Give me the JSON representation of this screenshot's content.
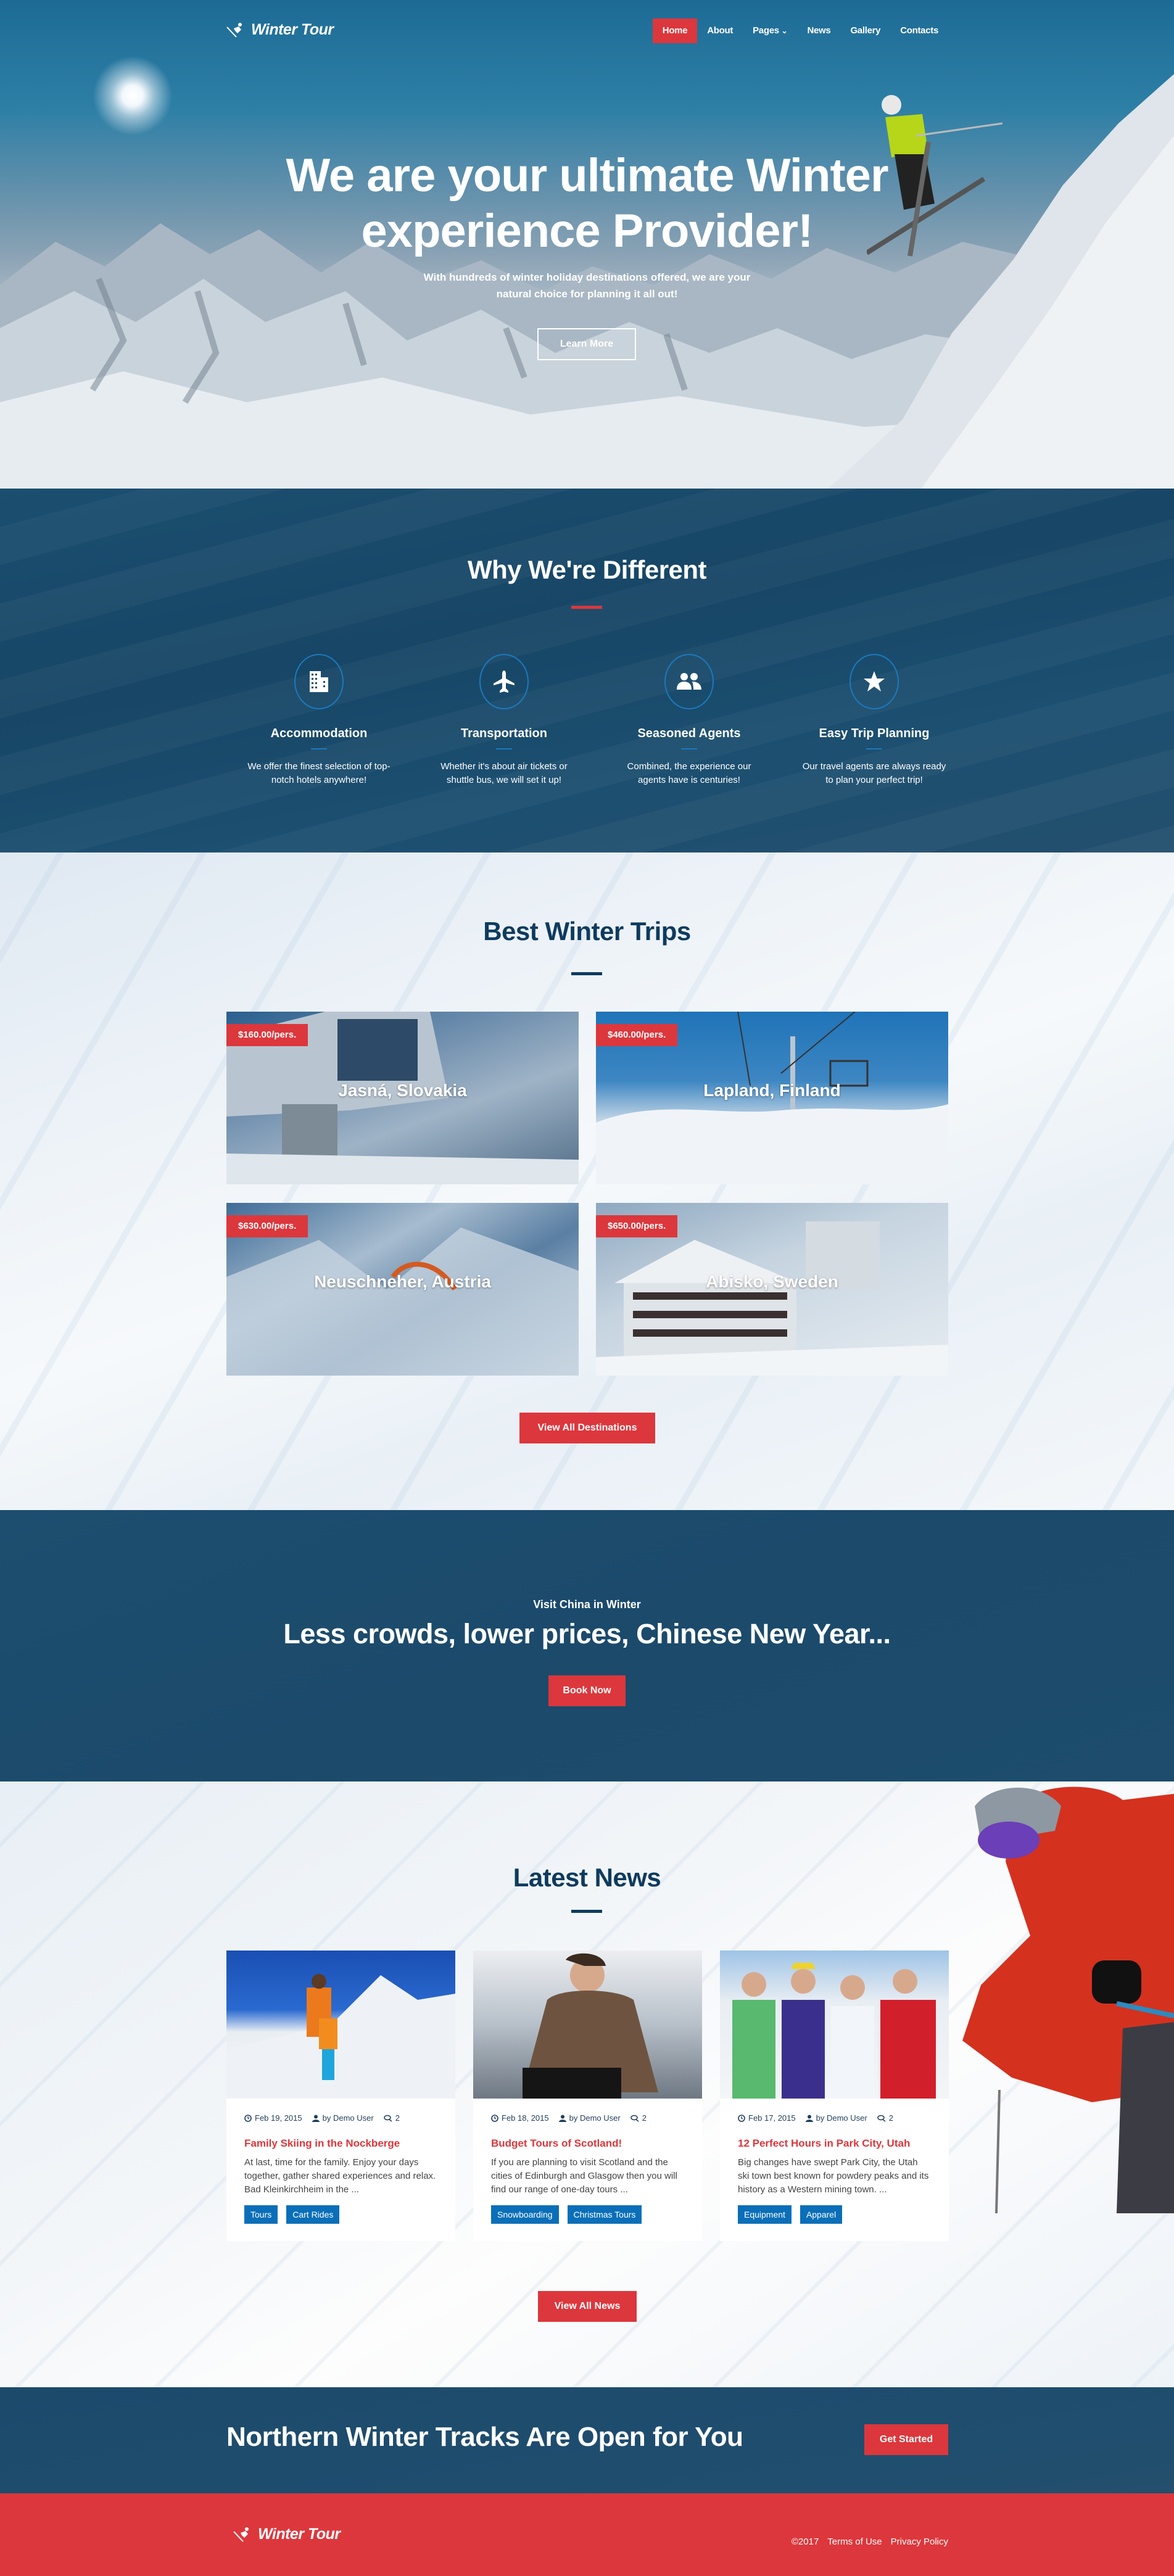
{
  "brand": {
    "name": "Winter Tour",
    "icon": "skier-logo-icon"
  },
  "nav": {
    "items": [
      {
        "label": "Home",
        "active": true
      },
      {
        "label": "About",
        "active": false
      },
      {
        "label": "Pages",
        "active": false,
        "has_dropdown": true
      },
      {
        "label": "News",
        "active": false
      },
      {
        "label": "Gallery",
        "active": false
      },
      {
        "label": "Contacts",
        "active": false
      }
    ],
    "dropdown_glyph": "⌄"
  },
  "hero": {
    "title_line1": "We are your ultimate Winter",
    "title_line2": "experience Provider!",
    "subtitle_line1": "With hundreds of winter holiday destinations offered, we are your",
    "subtitle_line2": "natural choice for planning it all out!",
    "button": "Learn More"
  },
  "why": {
    "title": "Why We're Different",
    "features": [
      {
        "icon": "building-icon",
        "title": "Accommodation",
        "text": "We offer the finest selection of top-notch hotels anywhere!"
      },
      {
        "icon": "airplane-icon",
        "title": "Transportation",
        "text": "Whether it's about air tickets or shuttle bus, we will set it up!"
      },
      {
        "icon": "people-icon",
        "title": "Seasoned Agents",
        "text": "Combined, the experience our agents have is centuries!"
      },
      {
        "icon": "star-icon",
        "title": "Easy Trip Planning",
        "text": "Our travel agents are always ready to plan your perfect trip!"
      }
    ]
  },
  "trips": {
    "title": "Best Winter Trips",
    "items": [
      {
        "price": "$160.00/pers.",
        "name": "Jasná, Slovakia"
      },
      {
        "price": "$460.00/pers.",
        "name": "Lapland, Finland"
      },
      {
        "price": "$630.00/pers.",
        "name": "Neuschneher, Austria"
      },
      {
        "price": "$650.00/pers.",
        "name": "Abisko, Sweden"
      }
    ],
    "button": "View All Destinations"
  },
  "cta": {
    "subtitle": "Visit China in Winter",
    "title": "Less crowds, lower prices, Chinese New Year...",
    "button": "Book Now"
  },
  "news": {
    "title": "Latest News",
    "posts": [
      {
        "date": "Feb 19, 2015",
        "author": "by Demo User",
        "comments": "2",
        "title": "Family Skiing in the Nockberge",
        "excerpt": "At last, time for the family. Enjoy your days together, gather shared experiences and relax. Bad Kleinkirchheim in the ...",
        "tags": [
          "Tours",
          "Cart Rides"
        ]
      },
      {
        "date": "Feb 18, 2015",
        "author": "by Demo User",
        "comments": "2",
        "title": "Budget Tours of Scotland!",
        "excerpt": "If you are planning to visit Scotland and the cities of Edinburgh and Glasgow then you will find our range of one-day tours ...",
        "tags": [
          "Snowboarding",
          "Christmas Tours"
        ]
      },
      {
        "date": "Feb 17, 2015",
        "author": "by Demo User",
        "comments": "2",
        "title": "12 Perfect Hours in Park City, Utah",
        "excerpt": "Big changes have swept Park City, the Utah ski town best known for powdery peaks and its history as a Western mining town. ...",
        "tags": [
          "Equipment",
          "Apparel"
        ]
      }
    ],
    "button": "View All News"
  },
  "tracks": {
    "title": "Northern Winter Tracks Are Open for You",
    "button": "Get Started"
  },
  "footer": {
    "copyright": "©2017",
    "links": [
      "Terms of Use",
      "Privacy Policy"
    ]
  },
  "colors": {
    "accent_red": "#dc373c",
    "navy": "#1b4a6b",
    "heading_navy": "#0e3b5e",
    "tag_blue": "#0a6fb8",
    "icon_ring_blue": "#1b79bd"
  }
}
